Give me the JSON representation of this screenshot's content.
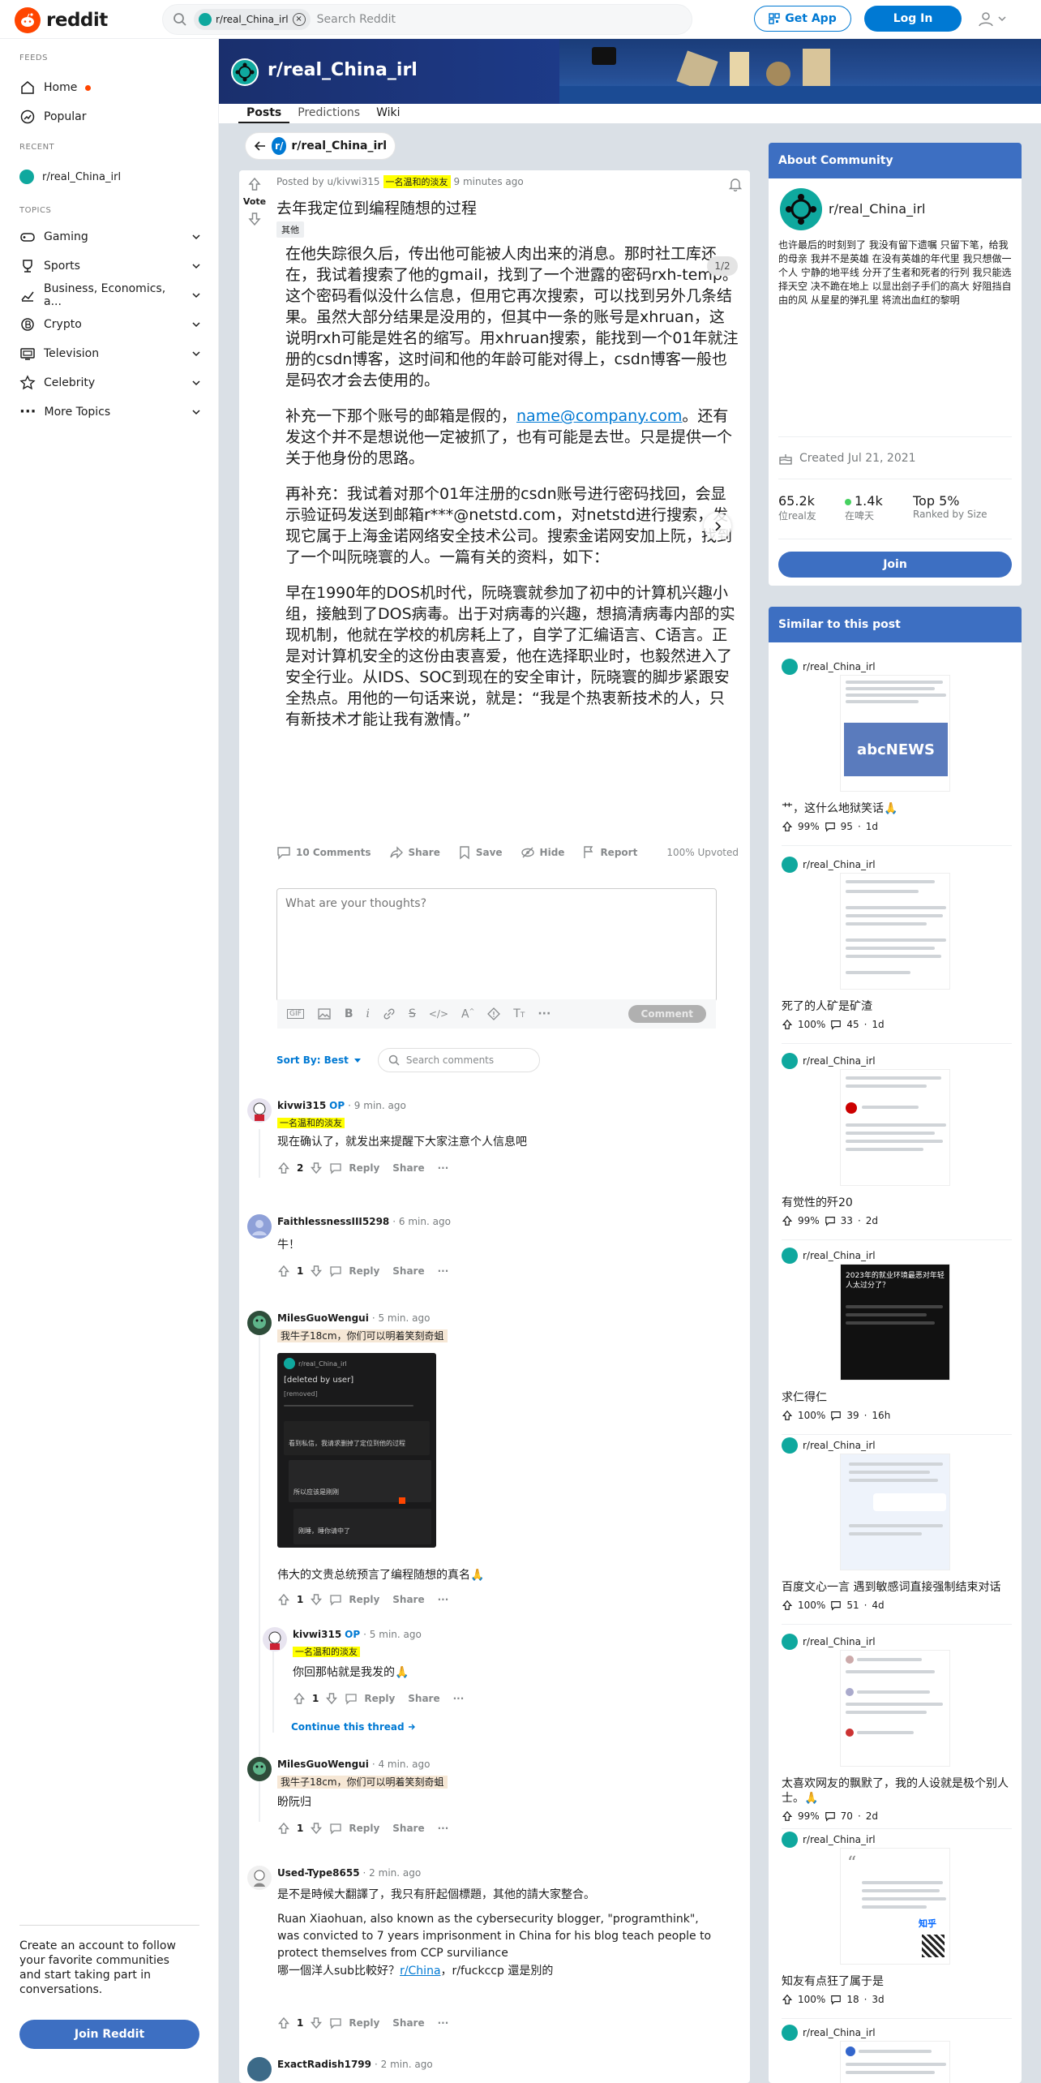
{
  "brand": {
    "name": "reddit",
    "color": "#ff4500",
    "accent": "#0079d3"
  },
  "header": {
    "search_chip": "r/real_China_irl",
    "search_placeholder": "Search Reddit",
    "get_app": "Get App",
    "login": "Log In"
  },
  "leftnav": {
    "feeds_heading": "FEEDS",
    "home": "Home",
    "popular": "Popular",
    "recent_heading": "RECENT",
    "recent_sub": "r/real_China_irl",
    "topics_heading": "TOPICS",
    "topics": [
      {
        "label": "Gaming",
        "icon": "gamepad-icon"
      },
      {
        "label": "Sports",
        "icon": "trophy-icon"
      },
      {
        "label": "Business, Economics, a...",
        "icon": "chart-icon"
      },
      {
        "label": "Crypto",
        "icon": "crypto-icon"
      },
      {
        "label": "Television",
        "icon": "tv-icon"
      },
      {
        "label": "Celebrity",
        "icon": "star-icon"
      },
      {
        "label": "More Topics",
        "icon": "more-icon"
      }
    ],
    "signup_text": "Create an account to follow your favorite communities and start taking part in conversations.",
    "join_button": "Join Reddit"
  },
  "subreddit": {
    "name": "r/real_China_irl",
    "tabs": [
      "Posts",
      "Predictions",
      "Wiki"
    ],
    "back_label": "r/real_China_irl",
    "icon_letter": "r/"
  },
  "post": {
    "vote_label": "Vote",
    "posted_by": "Posted by u/kivwi315",
    "author_flair": "一名温和的淡友",
    "time": "9 minutes ago",
    "title": "去年我定位到编程随想的过程",
    "flair": "其他",
    "page_indicator": "1/2",
    "para1": "在他失踪很久后，传出他可能被人肉出来的消息。那时社工库还在，我试着搜索了他的gmail，找到了一个泄露的密码rxh-temp。这个密码看似没什么信息，但用它再次搜索，可以找到另外几条结果。虽然大部分结果是没用的，但其中一条的账号是xhruan，这说明rxh可能是姓名的缩写。用xhruan搜索，能找到一个01年就注册的csdn博客，这时间和他的年龄可能对得上，csdn博客一般也是码农才会去使用的。",
    "para2_pre": "补充一下那个账号的邮箱是假的，",
    "para2_link": "name@company.com",
    "para2_post": "。还有发这个并不是想说他一定被抓了，也有可能是去世。只是提供一个关于他身份的思路。",
    "para3": "再补充：我试着对那个01年注册的csdn账号进行密码找回，会显示验证码发送到邮箱r***@netstd.com，对netstd进行搜索，发现它属于上海金诺网络安全技术公司。搜索金诺网安加上阮，找到了一个叫阮晓寰的人。一篇有关的资料，如下：",
    "para4": "早在1990年的DOS机时代，阮晓寰就参加了初中的计算机兴趣小组，接触到了DOS病毒。出于对病毒的兴趣，想搞清病毒内部的实现机制，他就在学校的机房耗上了，自学了汇编语言、C语言。正是对计算机安全的这份由衷喜爱，他在选择职业时，也毅然进入了安全行业。从IDS、SOC到现在的安全审计，阮晓寰的脚步紧跟安全热点。用他的一句话来说，就是：“我是个热衷新技术的人，只有新技术才能让我有激情。”",
    "actions": {
      "comments": "10 Comments",
      "share": "Share",
      "save": "Save",
      "hide": "Hide",
      "report": "Report"
    },
    "upvoted": "100% Upvoted"
  },
  "comment_box": {
    "placeholder": "What are your thoughts?",
    "submit": "Comment"
  },
  "sort": {
    "label": "Sort By: Best",
    "search_placeholder": "Search comments"
  },
  "comments": [
    {
      "user": "kivwi315",
      "op": "OP",
      "time": "· 9 min. ago",
      "flair": "一名温和的淡友",
      "text": "现在确认了，就发出来提醒下大家注意个人信息吧",
      "votes": "2"
    },
    {
      "user": "FaithlessnessIII5298",
      "op": "",
      "time": "· 6 min. ago",
      "flair": "",
      "text": "牛！",
      "votes": "1"
    },
    {
      "user": "MilesGuoWengui",
      "op": "",
      "time": "· 5 min. ago",
      "flair": "我牛子18cm，你们可以明着笑刻奇蛆",
      "text": "伟大的文贵总统预言了编程随想的真名🙏",
      "votes": "1"
    },
    {
      "user": "kivwi315",
      "op": "OP",
      "time": "· 5 min. ago",
      "flair": "一名温和的淡友",
      "text": "你回那帖就是我发的🙏",
      "votes": "1",
      "continue": "Continue this thread"
    },
    {
      "user": "MilesGuoWengui",
      "op": "",
      "time": "· 4 min. ago",
      "flair": "我牛子18cm，你们可以明着笑刻奇蛆",
      "text": "盼阮归",
      "votes": "1"
    },
    {
      "user": "Used-Type8655",
      "op": "",
      "time": "· 2 min. ago",
      "flair": "",
      "text": "是不是時候大翻譯了，我只有肝起個標題，其他的請大家整合。",
      "text2": "Ruan Xiaohuan, also known as the cybersecurity blogger, \"programthink\", was convicted to 7 years imprisonment in China for his blog teach people to protect themselves from CCP surviliance",
      "text3_pre": "哪一個洋人sub比較好？",
      "text3_link": "r/China",
      "text3_post": "，r/fuckccp 還是別的",
      "votes": "1"
    },
    {
      "user": "ExactRadish1799",
      "op": "",
      "time": "· 2 min. ago"
    }
  ],
  "comment_actions": {
    "reply": "Reply",
    "share": "Share",
    "more": "···"
  },
  "embedded_screenshot": {
    "sub": "r/real_China_irl",
    "deleted": "[deleted by user]",
    "removed": "[removed]",
    "line1": "看到私信，我请求删掉了定位到他的过程",
    "line2": "所以应该是刚刚",
    "line3": "刚睡，睡你请中了"
  },
  "about": {
    "heading": "About Community",
    "name": "r/real_China_irl",
    "description": "也许最后的时刻到了 我没有留下遗嘱 只留下笔，给我的母亲 我并不是英雄 在没有英雄的年代里 我只想做一个人 宁静的地平线 分开了生者和死者的行列 我只能选择天空 决不跪在地上 以显出刽子手们的高大 好阻挡自由的风 从星星的弹孔里 将流出血红的黎明",
    "created": "Created Jul 21, 2021",
    "members_value": "65.2k",
    "members_label": "位real友",
    "online_value": "1.4k",
    "online_label": "在啤天",
    "rank_value": "Top 5%",
    "rank_label": "Ranked by Size",
    "join": "Join"
  },
  "similar": {
    "heading": "Similar to this post",
    "items": [
      {
        "sub": "r/real_China_irl",
        "title": "艹，这什么地狱笑话🙏",
        "pct": "99%",
        "comments": "95",
        "age": "1d"
      },
      {
        "sub": "r/real_China_irl",
        "title": "死了的人矿是矿渣",
        "pct": "100%",
        "comments": "45",
        "age": "1d"
      },
      {
        "sub": "r/real_China_irl",
        "title": "有觉性的歼20",
        "pct": "99%",
        "comments": "33",
        "age": "2d"
      },
      {
        "sub": "r/real_China_irl",
        "title": "求仁得仁",
        "pct": "100%",
        "comments": "39",
        "age": "16h"
      },
      {
        "sub": "r/real_China_irl",
        "title": "百度文心一言 遇到敏感词直接强制结束对话",
        "pct": "100%",
        "comments": "51",
        "age": "4d"
      },
      {
        "sub": "r/real_China_irl",
        "title": "太喜欢网友的飘默了，我的人设就是极个别人士。🙏",
        "pct": "99%",
        "comments": "70",
        "age": "2d"
      },
      {
        "sub": "r/real_China_irl",
        "title": "知友有点狂了属于是",
        "pct": "100%",
        "comments": "18",
        "age": "3d"
      },
      {
        "sub": "r/real_China_irl",
        "title": "",
        "pct": "",
        "comments": "",
        "age": ""
      }
    ],
    "thumb_text": {
      "abc": "abcNEWS",
      "zhihu": "知乎",
      "date": "2023年的就业环境最恶对年轻人太过分了？"
    }
  }
}
